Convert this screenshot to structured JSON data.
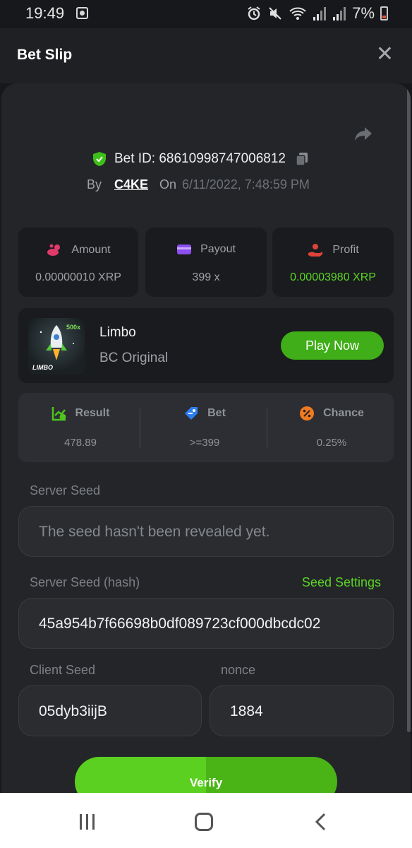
{
  "status_bar": {
    "time": "19:49",
    "battery": "7%",
    "icons": [
      "cast-icon",
      "alarm-icon",
      "mute-icon",
      "wifi-icon",
      "signal-icon",
      "signal-icon",
      "battery-icon"
    ]
  },
  "header": {
    "title": "Bet Slip",
    "close_symbol": "✕"
  },
  "bet": {
    "id_label": "Bet ID: 68610998747006812",
    "by_label": "By",
    "user": "C4KE",
    "on_label": "On",
    "date": "6/11/2022, 7:48:59 PM"
  },
  "stats": {
    "amount": {
      "label": "Amount",
      "value": "0.00000010 XRP"
    },
    "payout": {
      "label": "Payout",
      "value": "399 x"
    },
    "profit": {
      "label": "Profit",
      "value": "0.00003980 XRP"
    }
  },
  "game": {
    "name": "Limbo",
    "subtitle": "BC Original",
    "thumb_label": "LIMBO",
    "thumb_badge": "500x",
    "play_label": "Play Now"
  },
  "result": {
    "result": {
      "label": "Result",
      "value": "478.89"
    },
    "bet": {
      "label": "Bet",
      "value": ">=399"
    },
    "chance": {
      "label": "Chance",
      "value": "0.25%"
    }
  },
  "seeds": {
    "server_seed_label": "Server Seed",
    "server_seed_placeholder": "The seed hasn't been revealed yet.",
    "server_seed_hash_label": "Server Seed (hash)",
    "seed_settings_label": "Seed Settings",
    "server_seed_hash": "45a954b7f66698b0df089723cf000dbcdc02",
    "client_seed_label": "Client Seed",
    "client_seed": "05dyb3iijB",
    "nonce_label": "nonce",
    "nonce": "1884"
  },
  "verify_label": "Verify",
  "colors": {
    "accent_green": "#5bd424",
    "panel": "#232529",
    "card": "#1a1b1e"
  }
}
